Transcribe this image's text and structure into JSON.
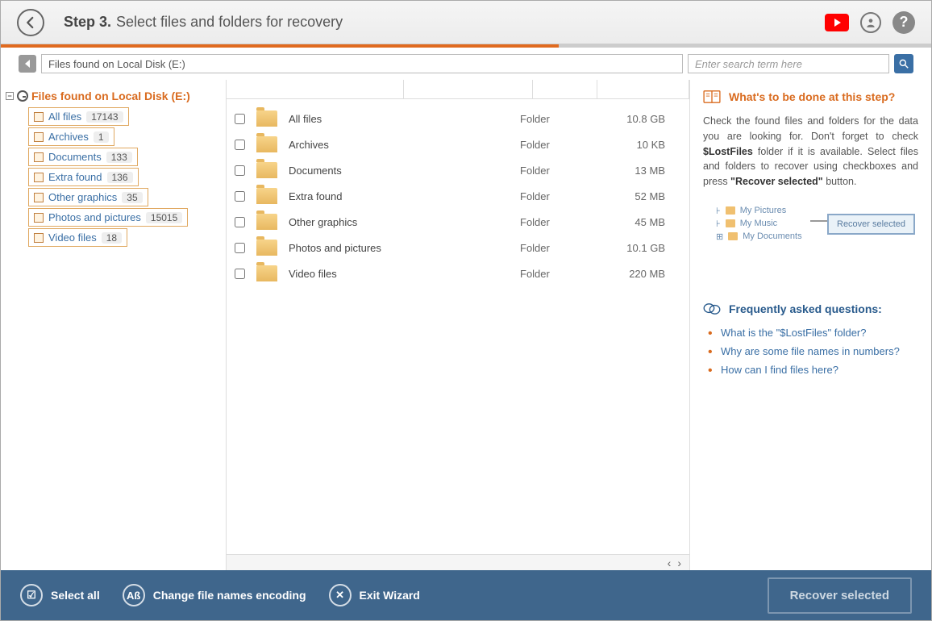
{
  "header": {
    "step": "Step 3.",
    "title": "Select files and folders for recovery"
  },
  "path": "Files found on Local Disk (E:)",
  "search_placeholder": "Enter search term here",
  "tree": {
    "root": "Files found on Local Disk (E:)",
    "items": [
      {
        "label": "All files",
        "count": "17143"
      },
      {
        "label": "Archives",
        "count": "1"
      },
      {
        "label": "Documents",
        "count": "133"
      },
      {
        "label": "Extra found",
        "count": "136"
      },
      {
        "label": "Other graphics",
        "count": "35"
      },
      {
        "label": "Photos and pictures",
        "count": "15015"
      },
      {
        "label": "Video files",
        "count": "18"
      }
    ]
  },
  "files": [
    {
      "name": "All files",
      "type": "Folder",
      "size": "10.8 GB"
    },
    {
      "name": "Archives",
      "type": "Folder",
      "size": "10 KB"
    },
    {
      "name": "Documents",
      "type": "Folder",
      "size": "13 MB"
    },
    {
      "name": "Extra found",
      "type": "Folder",
      "size": "52 MB"
    },
    {
      "name": "Other graphics",
      "type": "Folder",
      "size": "45 MB"
    },
    {
      "name": "Photos and pictures",
      "type": "Folder",
      "size": "10.1 GB"
    },
    {
      "name": "Video files",
      "type": "Folder",
      "size": "220 MB"
    }
  ],
  "sidebar": {
    "title": "What's to be done at this step?",
    "text_pre": "Check the found files and folders for the data you are looking for. Don't forget to check ",
    "lost": "$LostFiles",
    "text_mid": " folder if it is available. Select files and folders to recover using checkboxes and press ",
    "btnq": "\"Recover selected\"",
    "text_post": " button.",
    "illus": {
      "a": "My Pictures",
      "b": "My Music",
      "c": "My Documents",
      "btn": "Recover selected"
    },
    "faq_title": "Frequently asked questions:",
    "faq": [
      "What is the \"$LostFiles\" folder?",
      "Why are some file names in numbers?",
      "How can I find files here?"
    ]
  },
  "footer": {
    "select_all": "Select all",
    "encoding": "Change file names encoding",
    "exit": "Exit Wizard",
    "recover": "Recover selected"
  }
}
